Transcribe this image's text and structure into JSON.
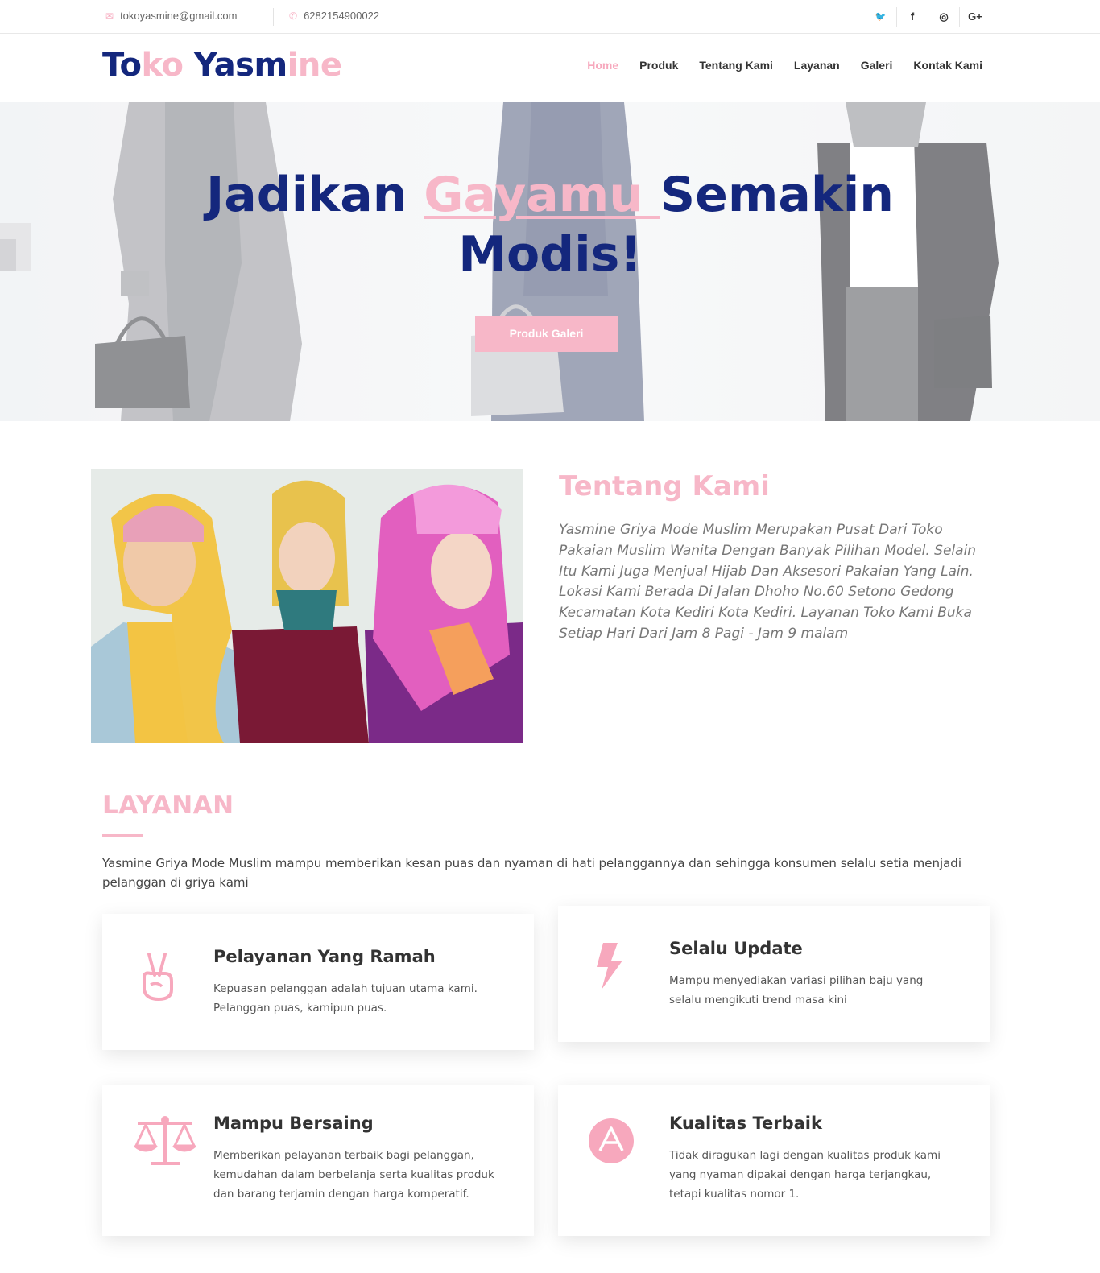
{
  "topbar": {
    "email": "tokoyasmine@gmail.com",
    "email_icon": "envelope-icon",
    "phone": "6282154900022",
    "phone_icon": "phone-icon",
    "social": [
      {
        "icon": "twitter-icon",
        "glyph": "🐦"
      },
      {
        "icon": "facebook-icon",
        "glyph": "f"
      },
      {
        "icon": "instagram-icon",
        "glyph": "◎"
      },
      {
        "icon": "google-plus-icon",
        "glyph": "G+"
      }
    ]
  },
  "header": {
    "logo_parts": [
      "To",
      "ko",
      " Yasm",
      "ine"
    ],
    "nav": [
      {
        "label": "Home",
        "active": true
      },
      {
        "label": "Produk",
        "active": false
      },
      {
        "label": "Tentang Kami",
        "active": false
      },
      {
        "label": "Layanan",
        "active": false
      },
      {
        "label": "Galeri",
        "active": false
      },
      {
        "label": "Kontak Kami",
        "active": false
      }
    ]
  },
  "hero": {
    "title_part1": "Jadikan ",
    "title_highlight": "Gayamu ",
    "title_part2": "Semakin",
    "title_line2": "Modis!",
    "button_label": "Produk Galeri"
  },
  "about": {
    "title": "Tentang Kami",
    "text": "Yasmine Griya Mode Muslim Merupakan Pusat Dari Toko Pakaian Muslim Wanita Dengan Banyak Pilihan Model. Selain Itu Kami Juga Menjual Hijab Dan Aksesori Pakaian Yang Lain. Lokasi Kami Berada Di Jalan Dhoho No.60 Setono Gedong Kecamatan Kota Kediri Kota Kediri. Layanan Toko Kami Buka Setiap Hari Dari Jam 8 Pagi - Jam 9 malam"
  },
  "layanan": {
    "title": "LAYANAN",
    "description": "Yasmine Griya Mode Muslim mampu memberikan kesan puas dan nyaman di hati pelanggannya dan sehingga konsumen selalu setia menjadi pelanggan di griya kami",
    "cards": [
      {
        "title": "Pelayanan Yang Ramah",
        "text": "Kepuasan pelanggan adalah tujuan utama kami. Pelanggan puas, kamipun puas.",
        "icon": "peace-hand-icon"
      },
      {
        "title": "Selalu Update",
        "text": "Mampu menyediakan variasi pilihan baju yang selalu mengikuti trend masa kini",
        "icon": "lightning-icon"
      },
      {
        "title": "Mampu Bersaing",
        "text": "Memberikan pelayanan terbaik bagi pelanggan, kemudahan dalam berbelanja serta kualitas produk dan barang terjamin dengan harga komperatif.",
        "icon": "balance-scale-icon"
      },
      {
        "title": "Kualitas Terbaik",
        "text": "Tidak diragukan lagi dengan kualitas produk kami yang nyaman dipakai dengan harga terjangkau, tetapi kualitas nomor 1.",
        "icon": "letter-a-badge-icon"
      }
    ]
  },
  "colors": {
    "navy": "#14277d",
    "pink": "#f7b7c8",
    "pink_accent": "#f7a8bd"
  }
}
